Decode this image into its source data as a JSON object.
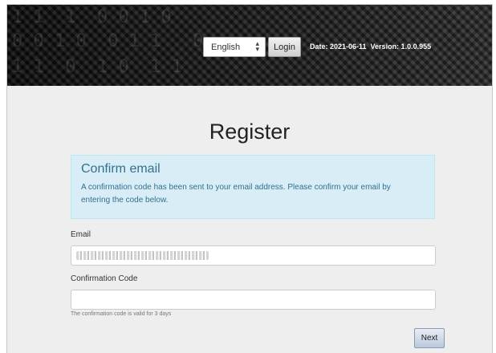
{
  "header": {
    "binary_rows": [
      "1 1  1  0 0 1 0",
      "0 0 1 0  0 1 1   0",
      "1 1  0  1 0  1 1"
    ],
    "language": {
      "selected": "English"
    },
    "login_label": "Login",
    "date_text": "Date: 2021-06-11",
    "version_text": "Version: 1.0.0.955"
  },
  "page": {
    "title": "Register"
  },
  "alert": {
    "heading": "Confirm email",
    "message": "A confirmation code has been sent to your email address. Please confirm your email by entering the code below."
  },
  "form": {
    "email_label": "Email",
    "code_label": "Confirmation Code",
    "code_value": "",
    "code_help": "The confirmation code is valid for 3 days",
    "next_label": "Next"
  }
}
